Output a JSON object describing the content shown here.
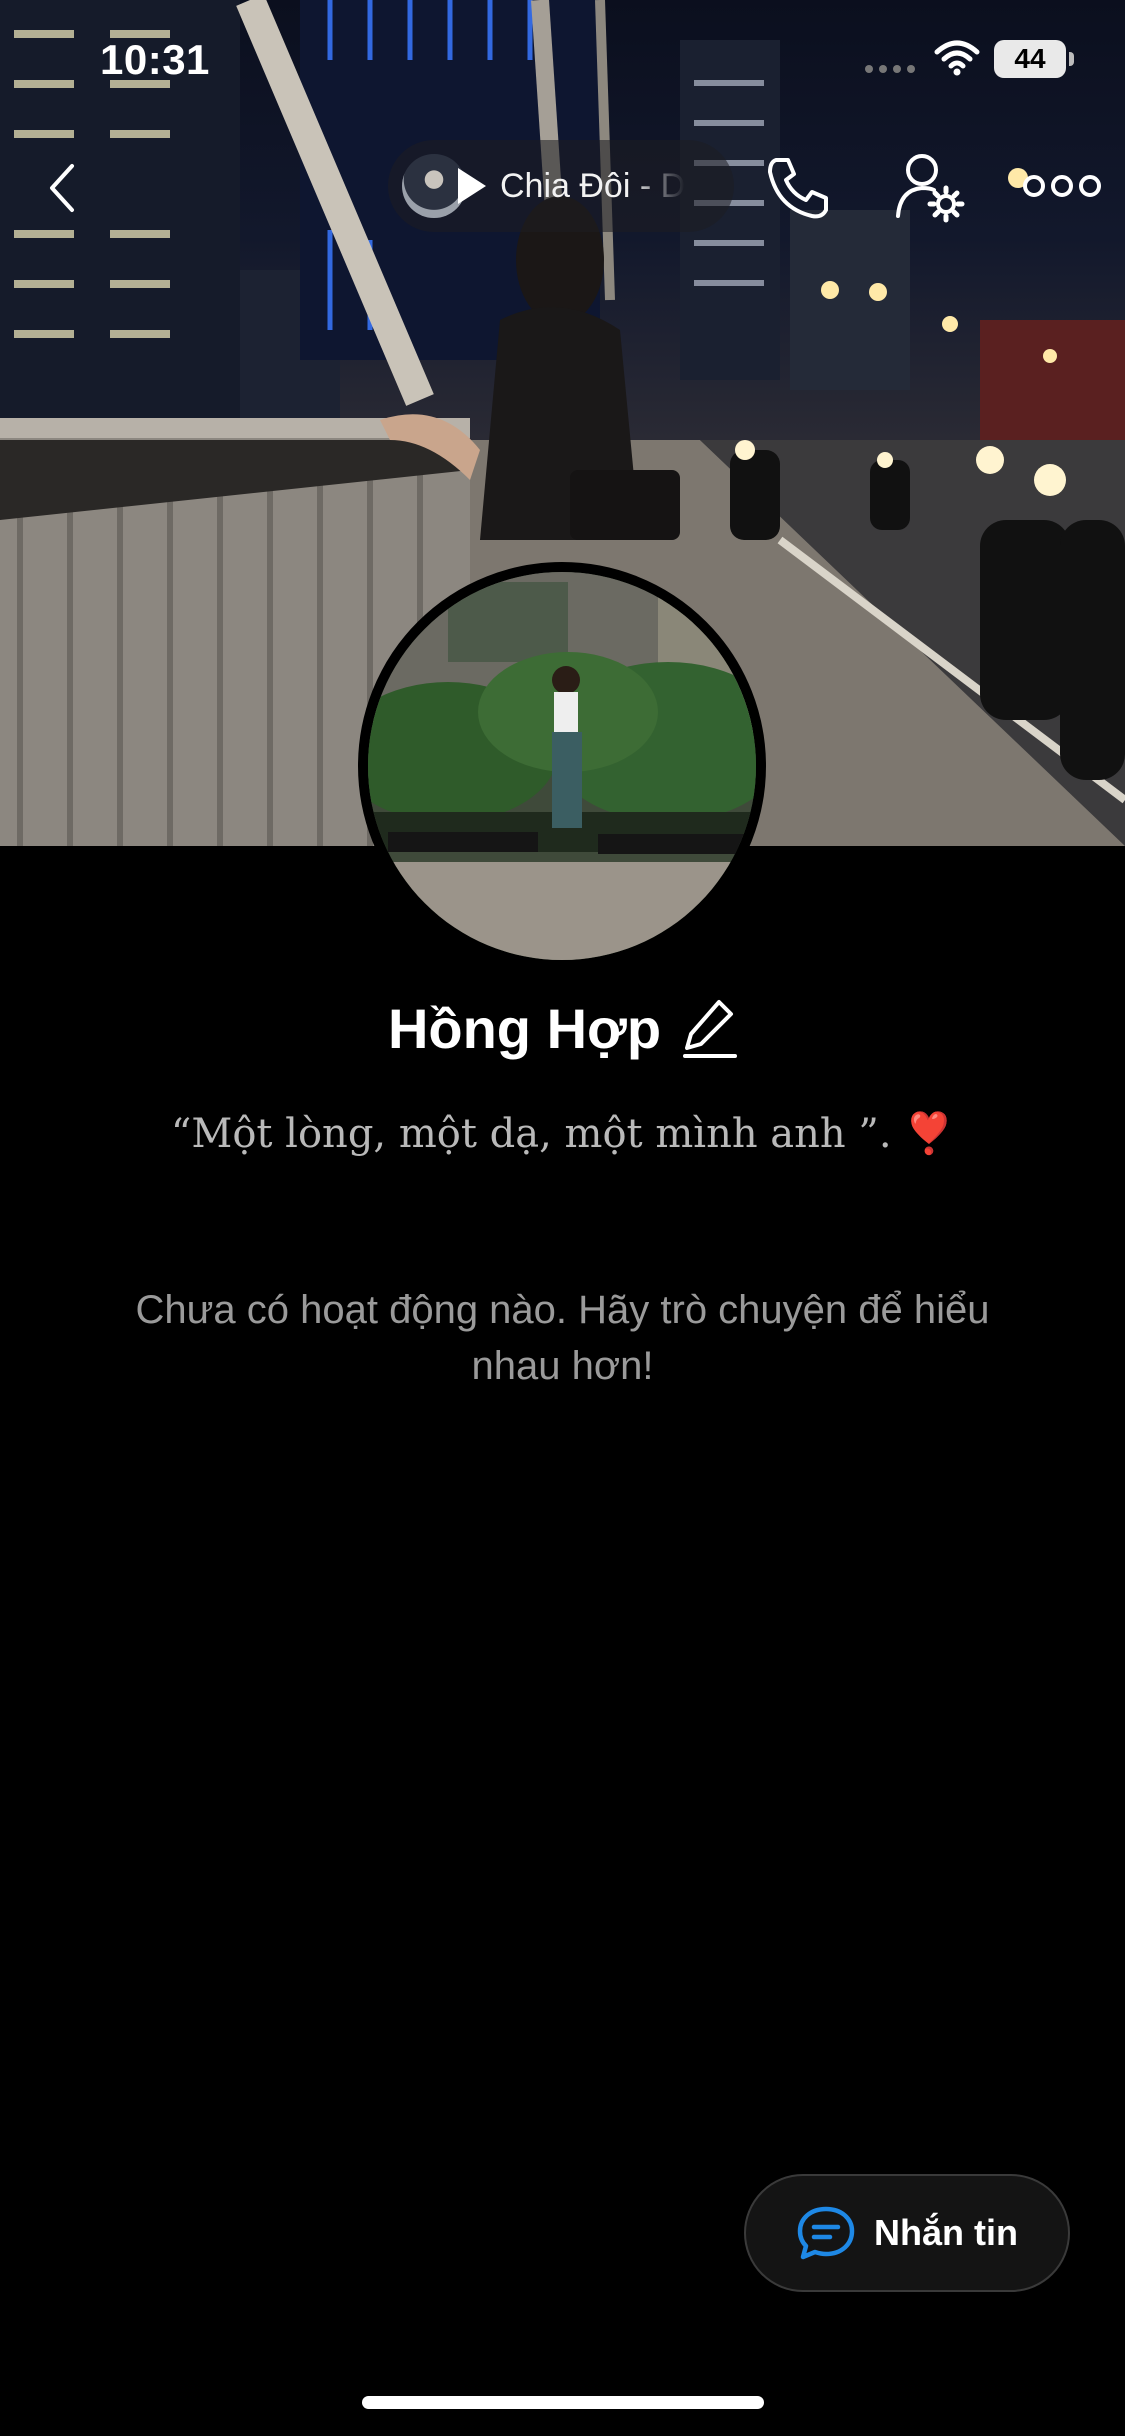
{
  "status_bar": {
    "time": "10:31",
    "battery": "44"
  },
  "header": {
    "back_icon": "chevron-left-icon",
    "music": {
      "title": "Chia Đôi - D",
      "play_icon": "play-icon"
    },
    "call_icon": "phone-icon",
    "settings_icon": "user-gear-icon",
    "more_icon": "more-dots-icon"
  },
  "profile": {
    "name": "Hồng Hợp",
    "edit_icon": "pencil-icon",
    "bio": "“Một lòng, một dạ, một mình anh ”.",
    "bio_emoji": "❣️"
  },
  "activity": {
    "empty_message": "Chưa có hoạt động nào. Hãy trò chuyện để hiểu nhau hơn!"
  },
  "actions": {
    "message_label": "Nhắn tin",
    "message_icon": "chat-bubble-icon",
    "accent_color": "#1e88e5"
  }
}
